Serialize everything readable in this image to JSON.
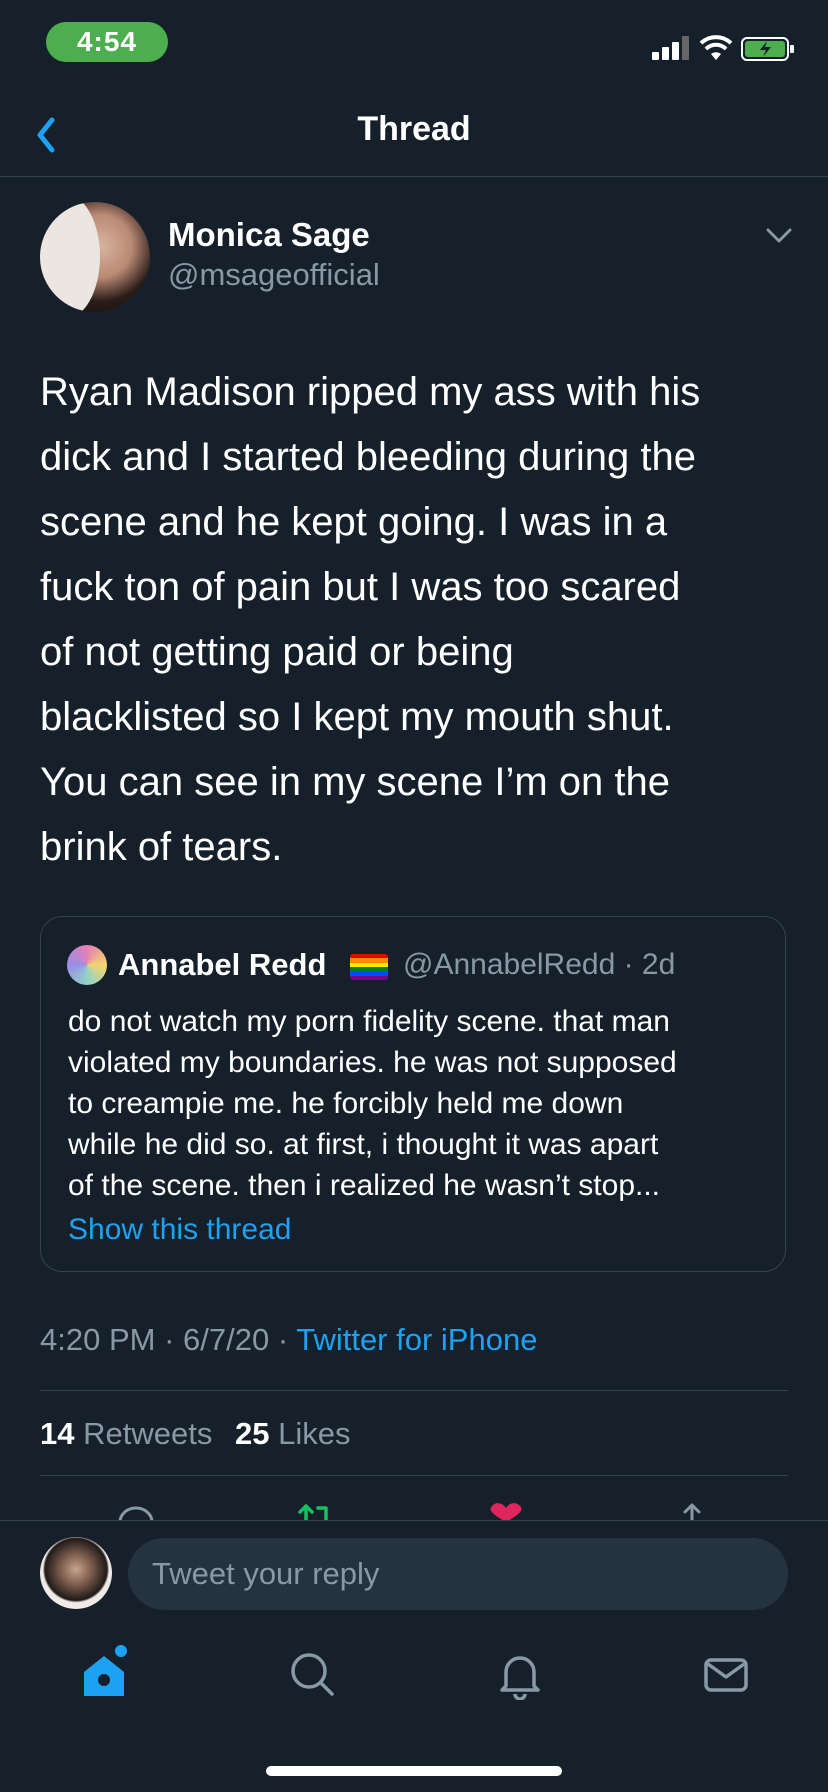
{
  "status_bar": {
    "time": "4:54"
  },
  "header": {
    "title": "Thread"
  },
  "tweet": {
    "author_name": "Monica Sage",
    "author_handle": "@msageofficial",
    "text": "Ryan Madison ripped my ass with his\ndick and I started bleeding during the\nscene and he kept going. I was in a\nfuck ton of pain but I was too scared\nof not getting paid or being\nblacklisted so I kept my mouth shut.\nYou can see in my scene I’m on the\nbrink of tears.",
    "time": "4:20 PM",
    "date": "6/7/20",
    "source": "Twitter for iPhone",
    "retweets_count": "14",
    "retweets_label": "Retweets",
    "likes_count": "25",
    "likes_label": "Likes"
  },
  "quoted_tweet": {
    "author_name": "Annabel Redd",
    "meta": "@AnnabelRedd · 2d",
    "text": "do not watch my porn fidelity scene. that man\nviolated my boundaries. he was not supposed\nto creampie me. he forcibly held me down\nwhile he did so. at first, i thought it was apart\nof the scene. then i realized he wasn’t stop...",
    "show_thread": "Show this thread"
  },
  "reply": {
    "placeholder": "Tweet your reply"
  },
  "separator": " · ",
  "colors": {
    "background": "#15202b",
    "accent": "#1da1f2",
    "muted": "#8899a6",
    "like": "#e0245e",
    "retweet": "#17bf63"
  },
  "icons": [
    "back-chevron-icon",
    "chevron-down-icon",
    "reply-icon",
    "retweet-icon",
    "like-icon",
    "share-icon",
    "home-icon",
    "search-icon",
    "notifications-icon",
    "messages-icon"
  ]
}
